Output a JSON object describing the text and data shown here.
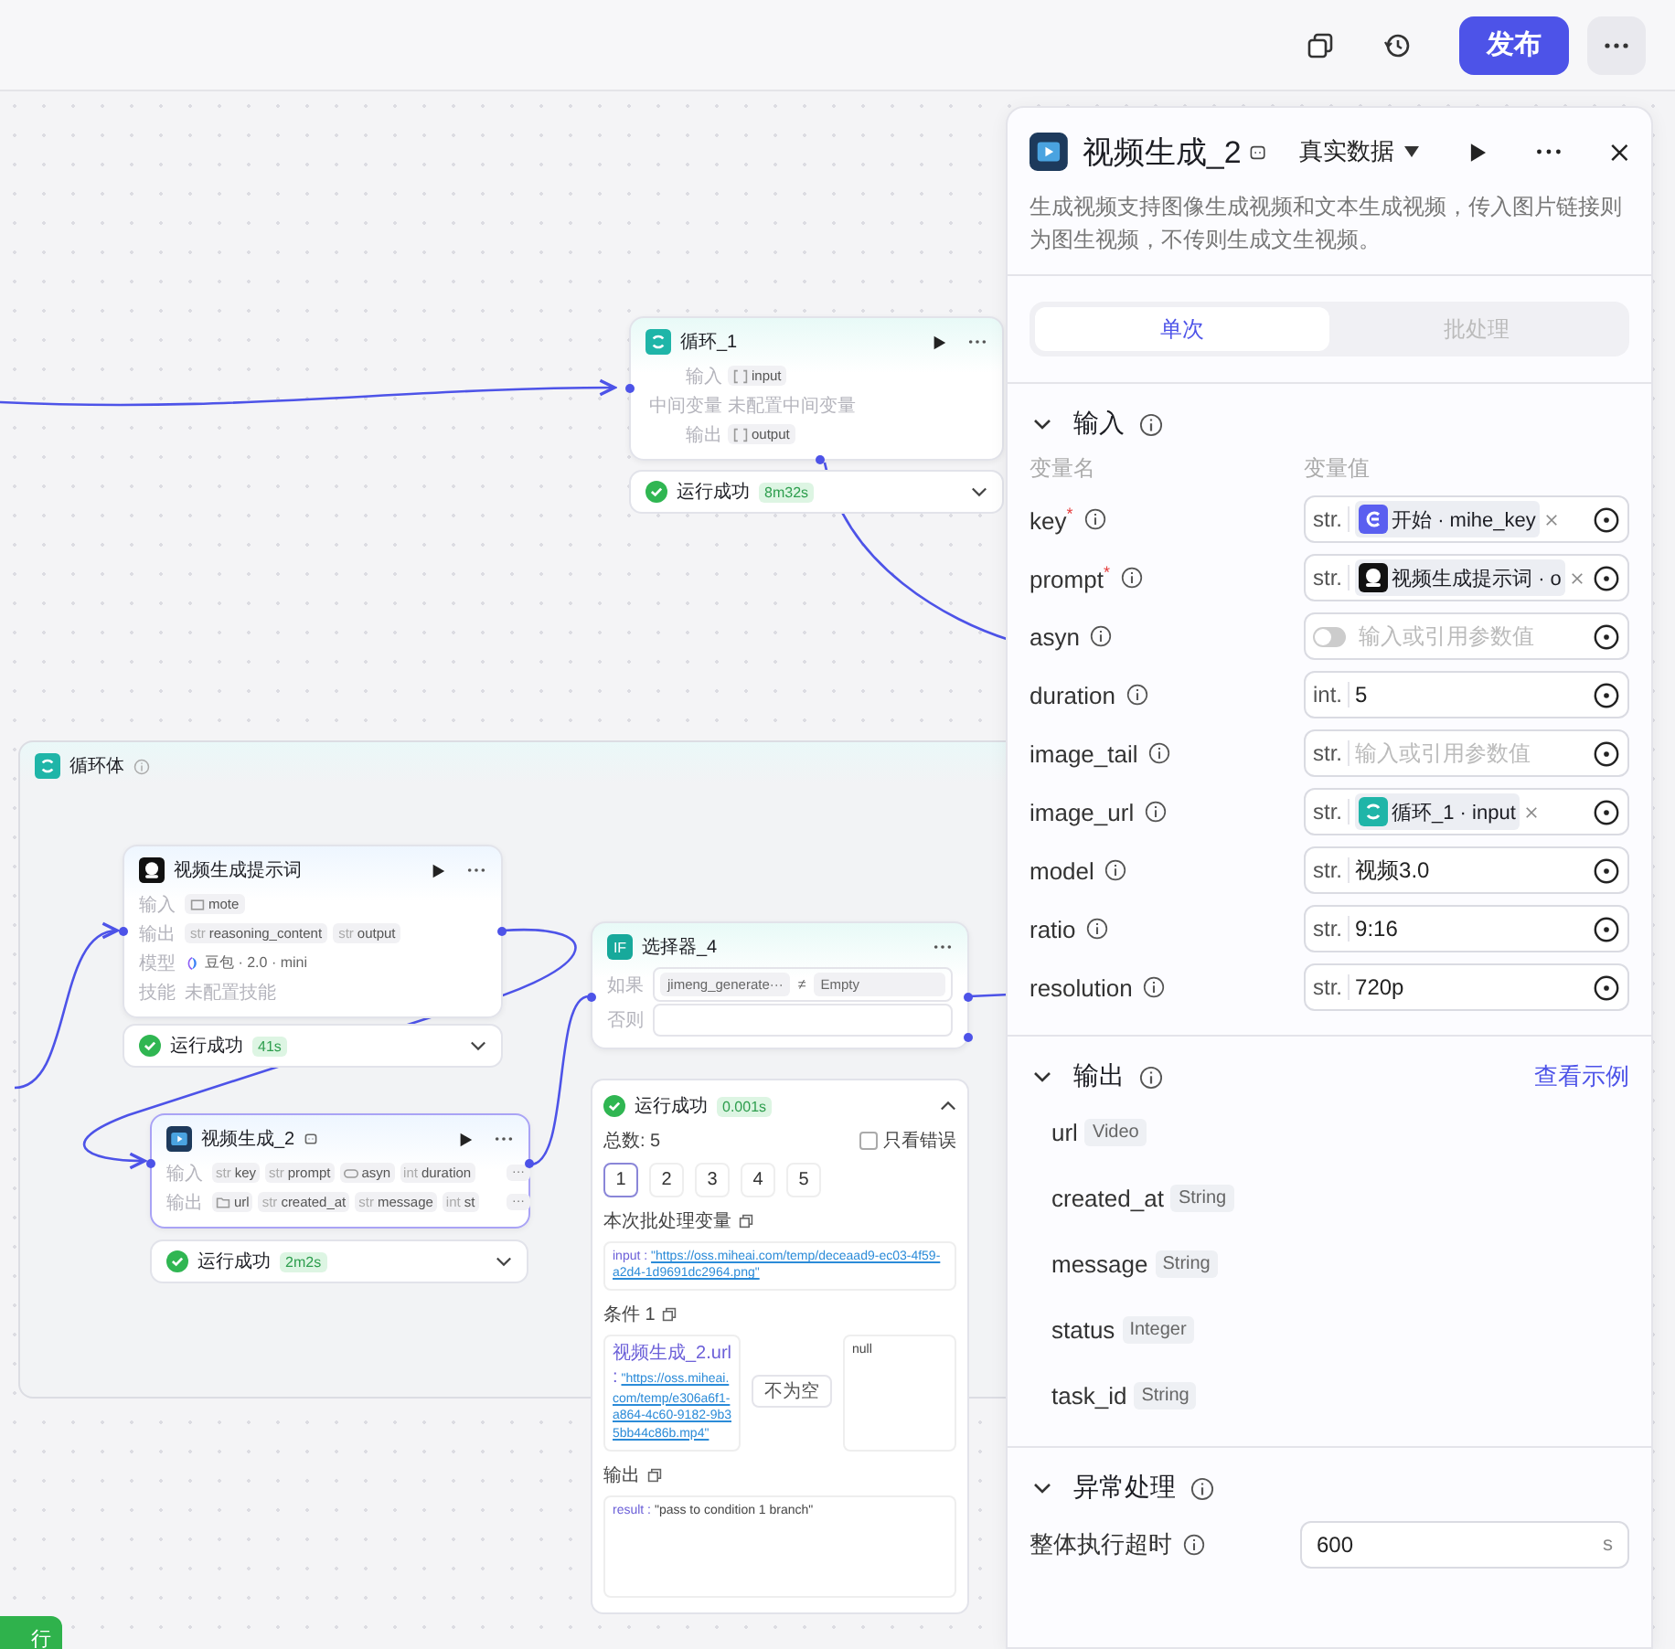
{
  "toolbar": {
    "publish": "发布"
  },
  "canvas": {
    "loop_node": {
      "title": "循环_1",
      "rows": [
        {
          "label": "输入",
          "chips": [
            {
              "kind": "array",
              "name": "input"
            }
          ]
        },
        {
          "label": "中间变量",
          "text": "未配置中间变量"
        },
        {
          "label": "输出",
          "chips": [
            {
              "kind": "array",
              "name": "output"
            }
          ]
        }
      ],
      "status": {
        "label": "运行成功",
        "time": "8m32s",
        "expanded": false
      }
    },
    "loop_body": {
      "title": "循环体"
    },
    "prompt_node": {
      "title": "视频生成提示词",
      "rows": [
        {
          "label": "输入",
          "chips": [
            {
              "kind": "image",
              "name": "mote"
            }
          ]
        },
        {
          "label": "输出",
          "chips": [
            {
              "prefix": "str",
              "name": "reasoning_content"
            },
            {
              "prefix": "str",
              "name": "output"
            }
          ]
        },
        {
          "label": "模型",
          "model": "豆包 · 2.0 · mini"
        },
        {
          "label": "技能",
          "text": "未配置技能"
        }
      ],
      "status": {
        "label": "运行成功",
        "time": "41s",
        "expanded": false
      }
    },
    "video_node": {
      "title": "视频生成_2",
      "selected": true,
      "rows": [
        {
          "label": "输入",
          "chips": [
            {
              "prefix": "str",
              "name": "key"
            },
            {
              "prefix": "str",
              "name": "prompt"
            },
            {
              "kind": "toggle",
              "name": "asyn"
            },
            {
              "prefix": "int",
              "name": "duration"
            }
          ],
          "more": "···"
        },
        {
          "label": "输出",
          "chips": [
            {
              "kind": "file",
              "name": "url"
            },
            {
              "prefix": "str",
              "name": "created_at"
            },
            {
              "prefix": "str",
              "name": "message"
            },
            {
              "prefix": "int",
              "name": "st"
            }
          ],
          "more": "···"
        }
      ],
      "status": {
        "label": "运行成功",
        "time": "2m2s",
        "expanded": false
      }
    },
    "selector_node": {
      "title": "选择器_4",
      "badge": "IF",
      "if_label": "如果",
      "else_label": "否则",
      "condition": {
        "left": "jimeng_generate···",
        "op": "≠",
        "right": "Empty"
      },
      "status": {
        "label": "运行成功",
        "time": "0.001s",
        "expanded": true
      },
      "details": {
        "total": "总数: 5",
        "errors_only": {
          "label": "只看错误",
          "checked": false
        },
        "pages": [
          {
            "label": "1",
            "selected": true
          },
          {
            "label": "2",
            "selected": false
          },
          {
            "label": "3",
            "selected": false
          },
          {
            "label": "4",
            "selected": false
          },
          {
            "label": "5",
            "selected": false
          }
        ],
        "batch_title": "本次批处理变量",
        "batch_var": {
          "name": "input :",
          "value": "\"https://oss.miheai.com/temp/deceaad9-ec03-4f59-a2d4-1d9691dc2964.png\""
        },
        "cond_title": "条件 1",
        "cond_left": {
          "name": "视频生成_2.url :",
          "value": "\"https://oss.miheai.com/temp/e306a6f1-a864-4c60-9182-9b35bb44c86b.mp4\""
        },
        "cond_op": "不为空",
        "cond_right": "null",
        "out_title": "输出",
        "out": {
          "name": "result :",
          "value": "\"pass to condition 1 branch\""
        }
      }
    },
    "bottom_button": "行"
  },
  "panel": {
    "title": "视频生成_2",
    "mode": "真实数据",
    "description": "生成视频支持图像生成视频和文本生成视频，传入图片链接则为图生视频，不传则生成文生视频。",
    "tabs": [
      {
        "label": "单次",
        "selected": true
      },
      {
        "label": "批处理",
        "selected": false
      }
    ],
    "input": {
      "title": "输入",
      "expanded": true,
      "col_name": "变量名",
      "col_value": "变量值",
      "params": [
        {
          "name": "key",
          "required_mark": "*",
          "type": "str.",
          "kind": "ref",
          "ref": {
            "kind": "start",
            "label": "开始 · mihe_key"
          }
        },
        {
          "name": "prompt",
          "required_mark": "*",
          "type": "str.",
          "kind": "ref",
          "ref": {
            "kind": "llm",
            "label": "视频生成提示词 · o"
          }
        },
        {
          "name": "asyn",
          "kind": "toggle",
          "on": false,
          "placeholder": "输入或引用参数值"
        },
        {
          "name": "duration",
          "type": "int.",
          "kind": "text",
          "value": "5"
        },
        {
          "name": "image_tail",
          "type": "str.",
          "kind": "text",
          "placeholder": "输入或引用参数值"
        },
        {
          "name": "image_url",
          "type": "str.",
          "kind": "ref",
          "ref": {
            "kind": "loop",
            "label": "循环_1 · input"
          }
        },
        {
          "name": "model",
          "type": "str.",
          "kind": "text",
          "value": "视频3.0"
        },
        {
          "name": "ratio",
          "type": "str.",
          "kind": "text",
          "value": "9:16"
        },
        {
          "name": "resolution",
          "type": "str.",
          "kind": "text",
          "value": "720p"
        }
      ]
    },
    "output": {
      "title": "输出",
      "expanded": true,
      "link": "查看示例",
      "fields": [
        {
          "name": "url",
          "type": "Video"
        },
        {
          "name": "created_at",
          "type": "String"
        },
        {
          "name": "message",
          "type": "String"
        },
        {
          "name": "status",
          "type": "Integer"
        },
        {
          "name": "task_id",
          "type": "String"
        }
      ]
    },
    "errors": {
      "title": "异常处理",
      "expanded": true,
      "timeout": {
        "label": "整体执行超时",
        "value": "600",
        "unit": "s"
      }
    }
  }
}
